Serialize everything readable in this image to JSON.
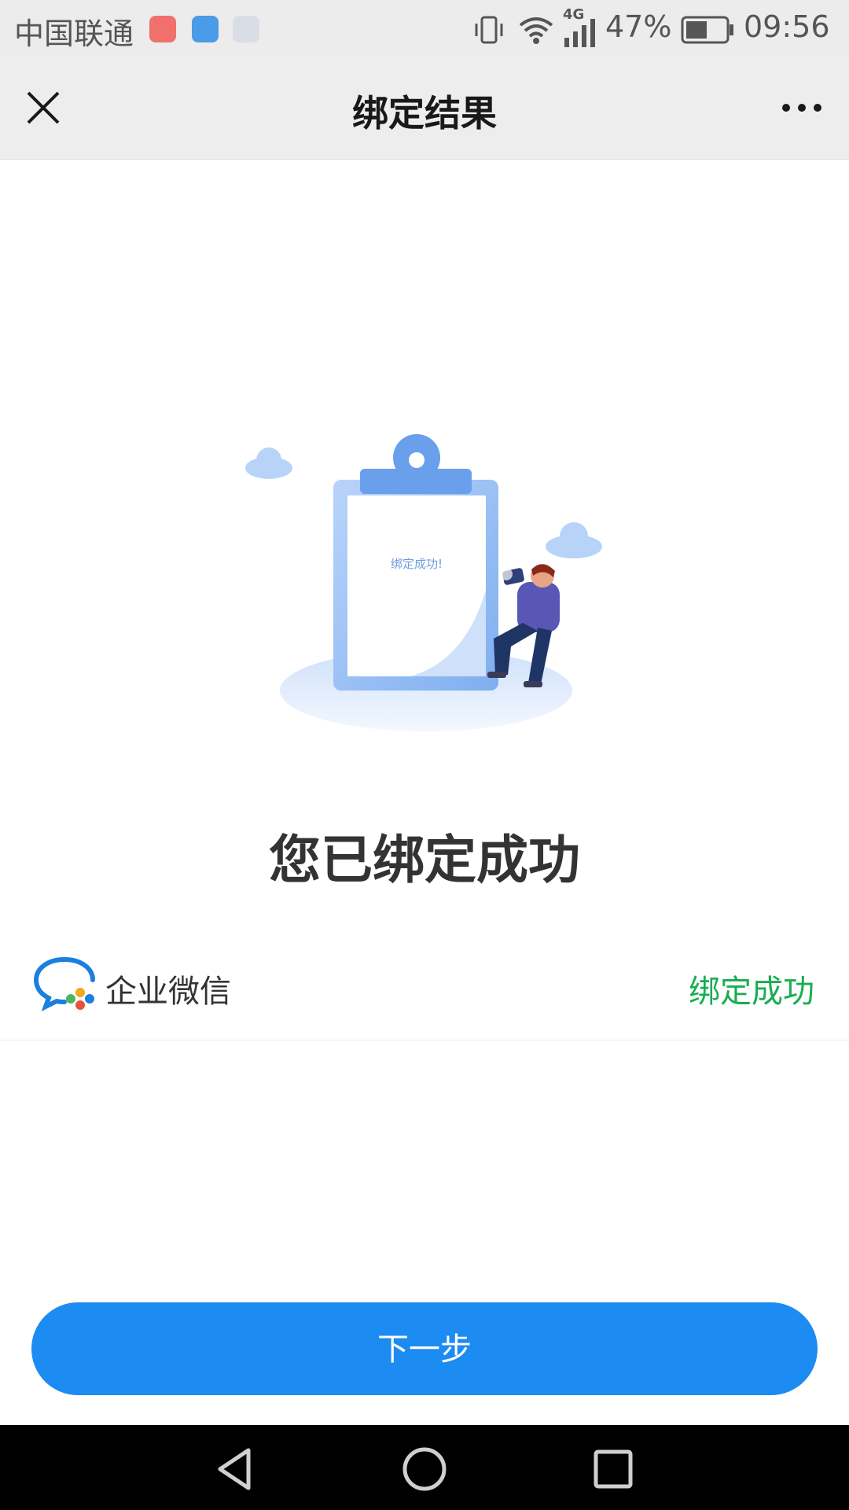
{
  "status_bar": {
    "carrier": "中国联通",
    "network": "4G",
    "battery": "47%",
    "time": "09:56"
  },
  "navbar": {
    "title": "绑定结果",
    "close_icon": "close-icon",
    "more_icon": "more-icon"
  },
  "illustration": {
    "clipboard_text": "绑定成功!"
  },
  "main": {
    "success_title": "您已绑定成功"
  },
  "binding": {
    "app_name": "企业微信",
    "status": "绑定成功",
    "status_color": "#1aad52"
  },
  "actions": {
    "next_label": "下一步",
    "button_color": "#1c8bf2"
  }
}
